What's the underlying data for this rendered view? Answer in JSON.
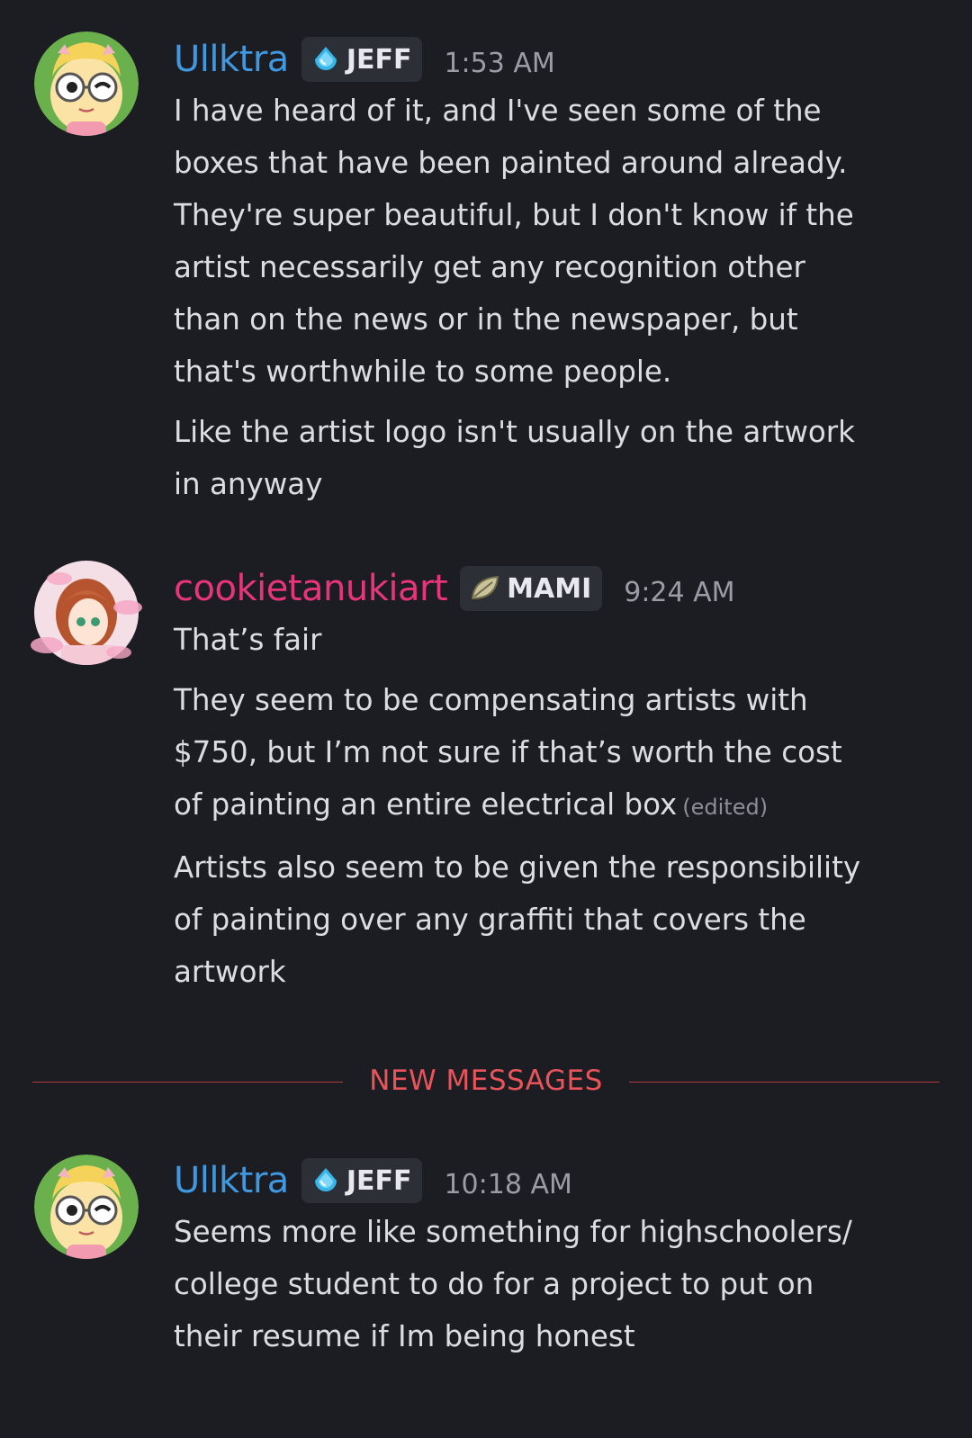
{
  "messages": [
    {
      "username": "Ullktra",
      "username_color": "#3f98e0",
      "tag": "JEFF",
      "tag_icon": "water-drop-icon",
      "time": "1:53 AM",
      "lines": [
        "I have heard of it, and I've seen some of the",
        "boxes that have been painted around already.",
        "They're super beautiful, but I don't know if the",
        "artist necessarily get any recognition other",
        "than on the news or in the newspaper, but",
        "that's worthwhile to some people.",
        "Like the artist logo isn't usually on the artwork",
        "in anyway"
      ]
    },
    {
      "username": "cookietanukiart",
      "username_color": "#e8347a",
      "tag": "MAMI",
      "tag_icon": "leaf-icon",
      "time": "9:24 AM",
      "lines": [
        "That’s fair",
        "They seem to be compensating artists with",
        "$750, but I’m not sure if that’s worth the cost",
        "of painting an entire electrical box",
        "Artists also seem to be given the responsibility",
        "of painting over any graffiti that covers the",
        "artwork"
      ],
      "edited_label": "(edited)"
    },
    {
      "username": "Ullktra",
      "username_color": "#3f98e0",
      "tag": "JEFF",
      "tag_icon": "water-drop-icon",
      "time": "10:18 AM",
      "lines": [
        "Seems more like something for highschoolers/",
        "college student to do for a project to put on",
        "their resume if Im being honest"
      ]
    }
  ],
  "divider": {
    "label": "NEW MESSAGES",
    "color": "#e8545a"
  }
}
